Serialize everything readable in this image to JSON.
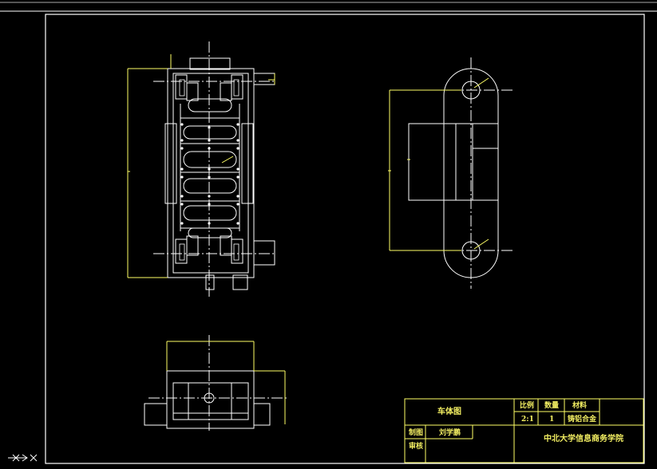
{
  "colors": {
    "background": "#000000",
    "frame": "#ffffff",
    "part_lines": "#ffffff",
    "center_lines": "#ffffff",
    "dimension_lines": "#ffff66",
    "title_text": "#f2ee62"
  },
  "title_block": {
    "drawing_name": "车体图",
    "scale_label": "比例",
    "quantity_label": "数量",
    "material_label": "材料",
    "scale_value": "2:1",
    "quantity_value": "1",
    "material_value": "铸铝合金",
    "drawn_label": "制图",
    "drawn_by": "刘学鹏",
    "checked_label": "审核",
    "school": "中北大学信息商务学院"
  },
  "icons": {
    "ucs": "ucs-axis-icon"
  }
}
